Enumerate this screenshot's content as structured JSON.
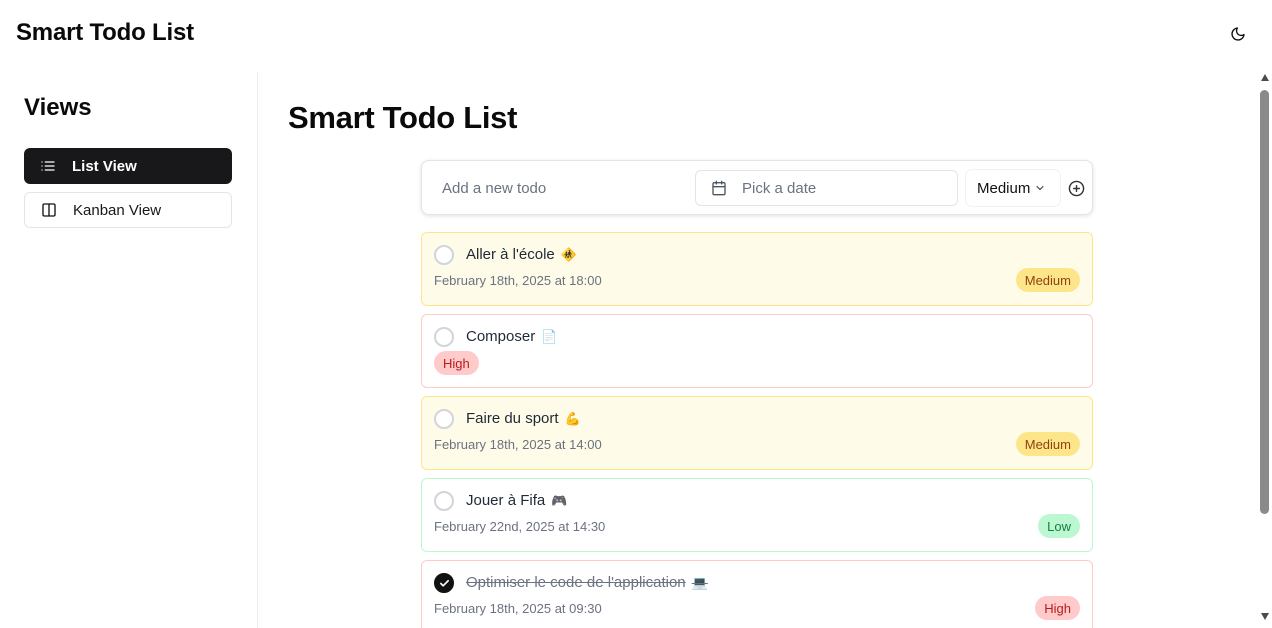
{
  "header": {
    "title": "Smart Todo List",
    "theme_toggle_icon": "moon-icon"
  },
  "sidebar": {
    "title": "Views",
    "items": [
      {
        "label": "List View",
        "icon": "list-icon",
        "active": true
      },
      {
        "label": "Kanban View",
        "icon": "columns-icon",
        "active": false
      }
    ]
  },
  "main": {
    "title": "Smart Todo List",
    "add_form": {
      "input_placeholder": "Add a new todo",
      "date_placeholder": "Pick a date",
      "priority_value": "Medium",
      "add_icon": "plus-circle-icon"
    },
    "todos": [
      {
        "title": "Aller à l'école",
        "emoji": "🚸",
        "date": "February 18th, 2025 at 18:00",
        "priority": "Medium",
        "completed": false
      },
      {
        "title": "Composer",
        "emoji": "📄",
        "date": "",
        "priority": "High",
        "completed": false
      },
      {
        "title": "Faire du sport",
        "emoji": "💪",
        "date": "February 18th, 2025 at 14:00",
        "priority": "Medium",
        "completed": false
      },
      {
        "title": "Jouer à Fifa",
        "emoji": "🎮",
        "date": "February 22nd, 2025 at 14:30",
        "priority": "Low",
        "completed": false
      },
      {
        "title": "Optimiser le code de l'application",
        "emoji": "💻",
        "date": "February 18th, 2025 at 09:30",
        "priority": "High",
        "completed": true
      }
    ]
  },
  "colors": {
    "medium_bg": "#fefce8",
    "medium_badge": "#fde68a",
    "high_border": "#fecaca",
    "low_border": "#bbf7d0",
    "active_nav": "#18181b"
  }
}
